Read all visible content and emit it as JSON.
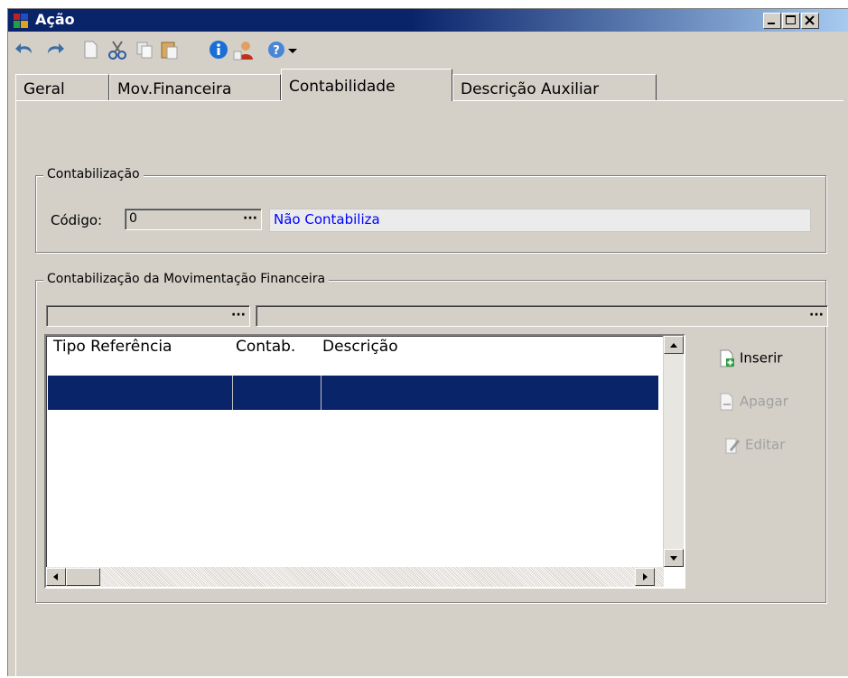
{
  "window": {
    "title": "Ação",
    "controls": {
      "minimize": "_",
      "maximize": "□",
      "close": "×"
    }
  },
  "toolbar": {
    "buttons": [
      {
        "name": "undo-icon"
      },
      {
        "name": "redo-icon"
      },
      {
        "name": "new-document-icon"
      },
      {
        "name": "cut-icon"
      },
      {
        "name": "copy-icon"
      },
      {
        "name": "paste-icon"
      },
      {
        "name": "info-icon"
      },
      {
        "name": "user-icon"
      },
      {
        "name": "help-icon"
      },
      {
        "name": "dropdown-arrow-icon"
      }
    ]
  },
  "tabs": [
    "Geral",
    "Mov.Financeira",
    "Contabilidade",
    "Descrição Auxiliar"
  ],
  "active_tab": "Contabilidade",
  "contabilizacao": {
    "legend": "Contabilização",
    "codigo_label": "Código:",
    "codigo_value": "0",
    "ellipsis": "···",
    "descricao_value": "Não Contabiliza"
  },
  "movimentacao": {
    "legend": "Contabilização da Movimentação Financeira",
    "ellipsis": "···",
    "columns": [
      "Tipo Referência",
      "Contab.",
      "Descrição"
    ]
  },
  "actions": {
    "inserir": "Inserir",
    "apagar": "Apagar",
    "editar": "Editar"
  },
  "colors": {
    "titlebar_start": "#0a246a",
    "titlebar_end": "#a6caf0",
    "selection": "#0a246a",
    "link_text": "#0000ff"
  }
}
